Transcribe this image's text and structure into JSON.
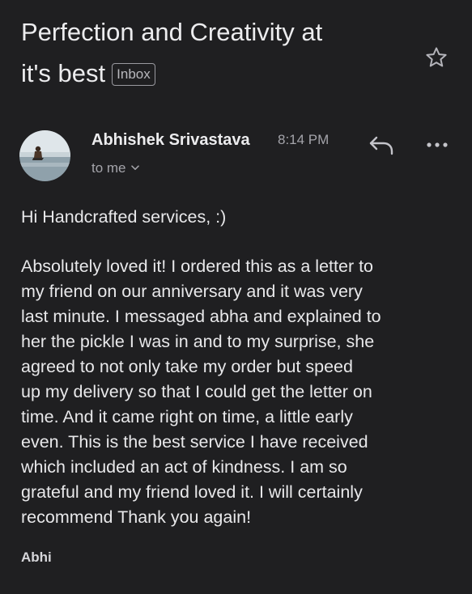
{
  "email": {
    "subject_line1": "Perfection and Creativity at",
    "subject_line2": "it's best",
    "label_badge": "Inbox",
    "starred": false,
    "sender": {
      "name": "Abhishek Srivastava",
      "time": "8:14 PM",
      "recipient": "to me"
    },
    "greeting": "Hi Handcrafted services, :)",
    "body_lines": [
      "Absolutely loved it! I ordered this as a letter to",
      "my friend on our anniversary and it was very",
      "last minute. I messaged abha and explained to",
      "her the pickle I was in and to my surprise, she",
      "agreed to not only take my order but speed",
      "up my delivery so that I could get the letter on",
      "time. And it came right on time, a little early",
      "even. This is the best service I have received",
      "which included an act of kindness. I am so",
      "grateful and my friend loved it. I will certainly",
      "recommend Thank you again!"
    ],
    "signature": "Abhi"
  },
  "icons": {
    "star": "star-outline-icon",
    "reply": "reply-icon",
    "more": "more-horizontal-icon",
    "chevron": "chevron-down-icon"
  },
  "colors": {
    "background": "#1f1f21",
    "text_primary": "#e8e8ea",
    "text_secondary": "#a4a4aa"
  }
}
